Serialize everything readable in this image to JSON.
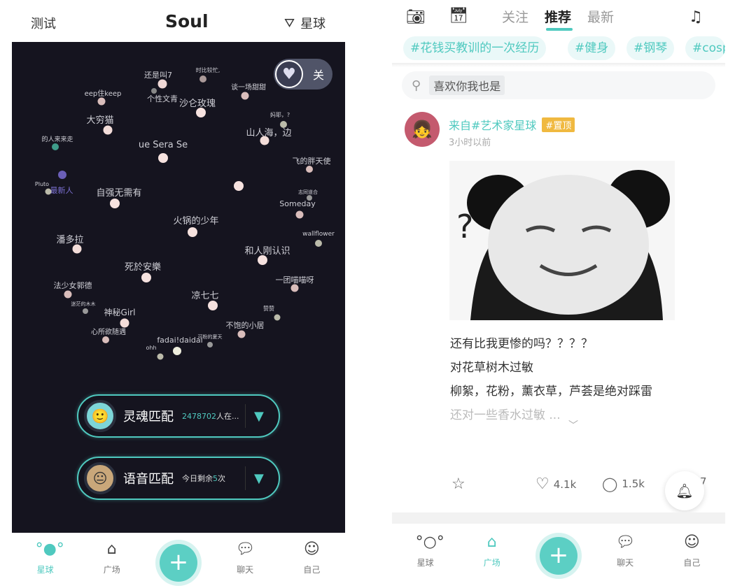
{
  "left": {
    "top_left_label": "测试",
    "app_title": "Soul",
    "filter_label": "星球",
    "toggle_label": "关",
    "nodes": [
      {
        "label": "还是叫7"
      },
      {
        "label": "时比较忙,"
      },
      {
        "label": "个性文青"
      },
      {
        "label": "沙仑玫瑰"
      },
      {
        "label": "谈一场甜甜"
      },
      {
        "label": "eep住keep"
      },
      {
        "label": "大穷猫"
      },
      {
        "label": "妈耶，?"
      },
      {
        "label": "山人海，边"
      },
      {
        "label": "的人来来走"
      },
      {
        "label": "最新人"
      },
      {
        "label": "ue Sera Se"
      },
      {
        "label": "飞的胖天使"
      },
      {
        "label": "自强无需有"
      },
      {
        "label": ""
      },
      {
        "label": "Someday"
      },
      {
        "label": "火锅的少年"
      },
      {
        "label": "潘多拉"
      },
      {
        "label": "wallflower"
      },
      {
        "label": "和人刚认识"
      },
      {
        "label": "死於安樂"
      },
      {
        "label": "一团喵喵呀"
      },
      {
        "label": "法少女郭德"
      },
      {
        "label": "凉七七"
      },
      {
        "label": "神秘Girl"
      },
      {
        "label": "心所欲随遇"
      },
      {
        "label": "不饱的小居"
      },
      {
        "label": "fadai!daidai"
      },
      {
        "label": "ohh"
      },
      {
        "label": "赞赞"
      },
      {
        "label": "Pluto"
      },
      {
        "label": "迷茫的木木"
      },
      {
        "label": "可粉的夏天"
      },
      {
        "label": "志同道合"
      }
    ],
    "soul_match": {
      "title": "灵魂匹配",
      "count": "2478702",
      "suffix": "人在..."
    },
    "voice_match": {
      "title": "语音匹配",
      "prefix": "今日剩余",
      "count": "5",
      "suffix": "次"
    },
    "tabs": [
      {
        "label": "星球",
        "icon": "planet-icon",
        "active": true
      },
      {
        "label": "广场",
        "icon": "square-icon",
        "active": false
      },
      {
        "label": "聊天",
        "icon": "chat-icon",
        "active": false
      },
      {
        "label": "自己",
        "icon": "smile-icon",
        "active": false
      }
    ]
  },
  "right": {
    "feed_tabs": [
      "关注",
      "推荐",
      "最新"
    ],
    "active_tab": "推荐",
    "tags": [
      "#花钱买教训的一次经历",
      "#健身",
      "#钢琴",
      "#cosp"
    ],
    "search_hint": "喜欢你我也是",
    "post": {
      "source": "来自#艺术家星球",
      "pin": "#置顶",
      "time": "3小时以前",
      "lines": [
        "还有比我更惨的吗？？？？",
        "对花草树木过敏",
        "柳絮，花粉，薰衣草，芦荟是绝对踩雷",
        "还对一些香水过敏 ..."
      ],
      "likes": "4.1k",
      "comments": "1.5k",
      "shares": "7"
    },
    "tabs": [
      {
        "label": "星球",
        "icon": "planet-icon",
        "active": false
      },
      {
        "label": "广场",
        "icon": "square-icon",
        "active": true
      },
      {
        "label": "聊天",
        "icon": "chat-icon",
        "active": false
      },
      {
        "label": "自己",
        "icon": "smile-icon",
        "active": false
      }
    ]
  },
  "colors": {
    "accent": "#4fc9bf",
    "panel_bg": "#15141f",
    "pin": "#f0b940"
  }
}
